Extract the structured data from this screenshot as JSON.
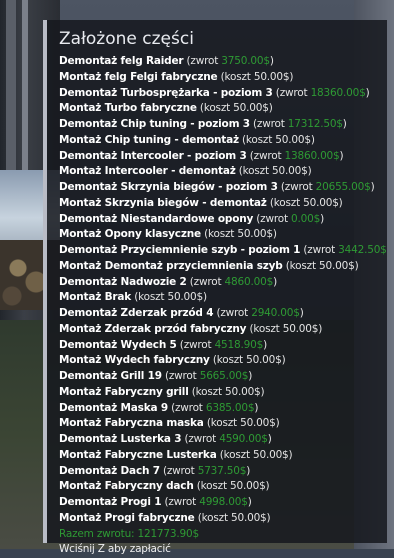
{
  "panel": {
    "title": "Założone części",
    "rows": [
      {
        "action": "Demontaż felg Raider",
        "prefix": " (zwrot ",
        "money": "3750.00$",
        "suffix": ")"
      },
      {
        "action": "Montaż felg Felgi fabryczne",
        "prefix": " (koszt 50.00$)",
        "money": "",
        "suffix": ""
      },
      {
        "action": "Demontaż Turbosprężarka - poziom 3",
        "prefix": " (zwrot ",
        "money": "18360.00$",
        "suffix": ")"
      },
      {
        "action": "Montaż Turbo fabryczne",
        "prefix": " (koszt 50.00$)",
        "money": "",
        "suffix": ""
      },
      {
        "action": "Demontaż Chip tuning - poziom 3",
        "prefix": " (zwrot ",
        "money": "17312.50$",
        "suffix": ")"
      },
      {
        "action": "Montaż Chip tuning - demontaż",
        "prefix": " (koszt 50.00$)",
        "money": "",
        "suffix": ""
      },
      {
        "action": "Demontaż Intercooler - poziom 3",
        "prefix": " (zwrot ",
        "money": "13860.00$",
        "suffix": ")"
      },
      {
        "action": "Montaż Intercooler - demontaż",
        "prefix": " (koszt 50.00$)",
        "money": "",
        "suffix": ""
      },
      {
        "action": "Demontaż Skrzynia biegów - poziom 3",
        "prefix": " (zwrot ",
        "money": "20655.00$",
        "suffix": ")"
      },
      {
        "action": "Montaż Skrzynia biegów - demontaż",
        "prefix": " (koszt 50.00$)",
        "money": "",
        "suffix": ""
      },
      {
        "action": "Demontaż Niestandardowe opony",
        "prefix": " (zwrot ",
        "money": "0.00$",
        "suffix": ")"
      },
      {
        "action": "Montaż Opony klasyczne",
        "prefix": " (koszt 50.00$)",
        "money": "",
        "suffix": ""
      },
      {
        "action": "Demontaż Przyciemnienie szyb - poziom 1",
        "prefix": " (zwrot ",
        "money": "3442.50$",
        "suffix": ")"
      },
      {
        "action": "Montaż Demontaż przyciemnienia szyb",
        "prefix": " (koszt 50.00$)",
        "money": "",
        "suffix": ""
      },
      {
        "action": "Demontaż Nadwozie 2",
        "prefix": " (zwrot ",
        "money": "4860.00$",
        "suffix": ")"
      },
      {
        "action": "Montaż Brak",
        "prefix": " (koszt 50.00$)",
        "money": "",
        "suffix": ""
      },
      {
        "action": "Demontaż Zderzak przód 4",
        "prefix": " (zwrot ",
        "money": "2940.00$",
        "suffix": ")"
      },
      {
        "action": "Montaż Zderzak przód fabryczny",
        "prefix": " (koszt 50.00$)",
        "money": "",
        "suffix": ""
      },
      {
        "action": "Demontaż Wydech 5",
        "prefix": " (zwrot ",
        "money": "4518.90$",
        "suffix": ")"
      },
      {
        "action": "Montaż Wydech fabryczny",
        "prefix": " (koszt 50.00$)",
        "money": "",
        "suffix": ""
      },
      {
        "action": "Demontaż Grill 19",
        "prefix": " (zwrot ",
        "money": "5665.00$",
        "suffix": ")"
      },
      {
        "action": "Montaż Fabryczny grill",
        "prefix": " (koszt 50.00$)",
        "money": "",
        "suffix": ""
      },
      {
        "action": "Demontaż Maska 9",
        "prefix": " (zwrot ",
        "money": "6385.00$",
        "suffix": ")"
      },
      {
        "action": "Montaż Fabryczna maska",
        "prefix": " (koszt 50.00$)",
        "money": "",
        "suffix": ""
      },
      {
        "action": "Demontaż Lusterka 3",
        "prefix": " (zwrot ",
        "money": "4590.00$",
        "suffix": ")"
      },
      {
        "action": "Montaż Fabryczne Lusterka",
        "prefix": " (koszt 50.00$)",
        "money": "",
        "suffix": ""
      },
      {
        "action": "Demontaż Dach 7",
        "prefix": " (zwrot ",
        "money": "5737.50$",
        "suffix": ")"
      },
      {
        "action": "Montaż Fabryczny dach",
        "prefix": " (koszt 50.00$)",
        "money": "",
        "suffix": ""
      },
      {
        "action": "Demontaż Progi 1",
        "prefix": " (zwrot ",
        "money": "4998.00$",
        "suffix": ")"
      },
      {
        "action": "Montaż Progi fabryczne",
        "prefix": " (koszt 50.00$)",
        "money": "",
        "suffix": ""
      }
    ],
    "summary": "Razem zwrotu: 121773.90$",
    "hint": "Wciśnij Z aby zapłacić"
  },
  "colors": {
    "money_green": "#2e9a34",
    "panel_bg": "#16181e",
    "panel_border": "#b9bcc6"
  }
}
